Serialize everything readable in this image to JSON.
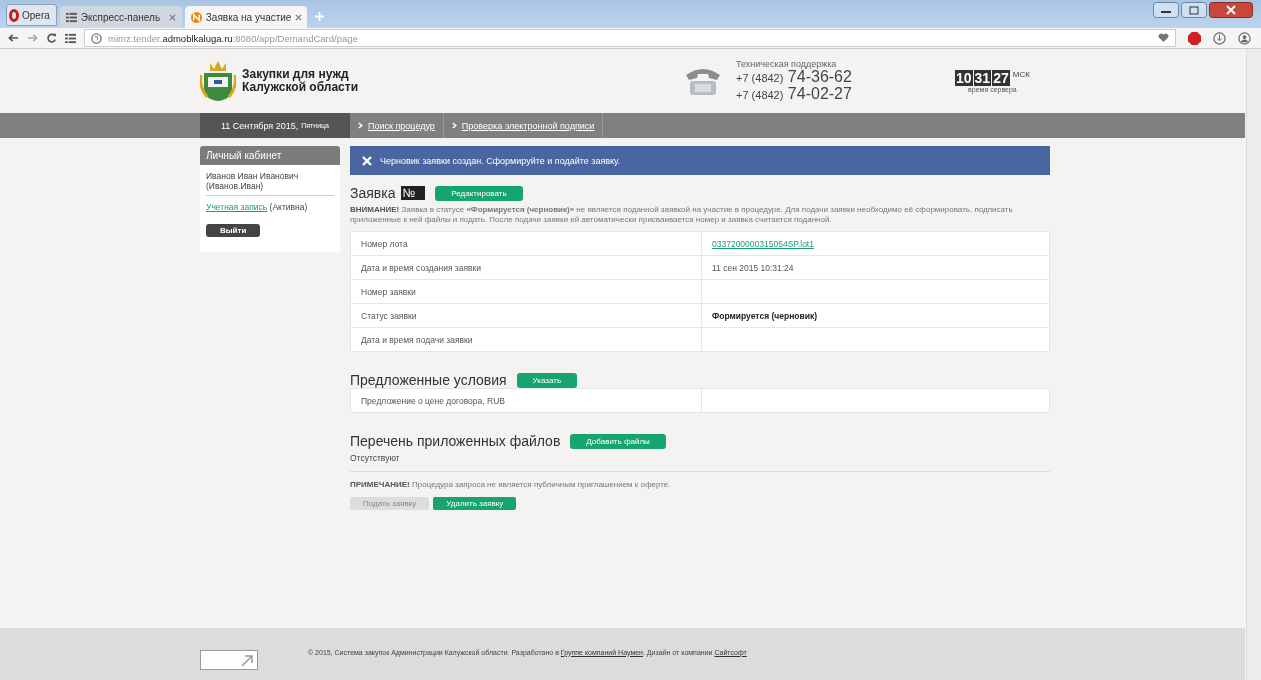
{
  "browser": {
    "menu_label": "Opera",
    "tabs": [
      {
        "label": "Экспресс-панель",
        "selected": false
      },
      {
        "label": "Заявка на участие",
        "selected": true
      }
    ],
    "url": {
      "prefix": "mimz.tender.",
      "host": "admoblkaluga.ru",
      "suffix": ":8080/app/DemandCard/page"
    }
  },
  "header": {
    "logo_text": [
      "Закупки для нужд",
      "Калужской области"
    ],
    "support_label": "Техническая поддержка",
    "phones": [
      {
        "code": "+7 (4842)",
        "number": "74-36-62"
      },
      {
        "code": "+7 (4842)",
        "number": "74-02-27"
      }
    ],
    "clock": {
      "digits": [
        "10",
        "31",
        "27"
      ],
      "zone": "МСК",
      "caption": "время сервера"
    }
  },
  "nav": {
    "date": "11 Сентября 2015,",
    "weekday": "Пятница",
    "links": [
      "Поиск процедур",
      "Проверка электронной подписи"
    ]
  },
  "sidebar": {
    "title": "Личный кабинет",
    "user": "Иванов Иван Иванович (Иванов.Иван)",
    "account_link": "Учетная запись",
    "account_status": "(Активна)",
    "logout": "Выйти"
  },
  "notice": "Черновик заявки создан. Сформируйте и подайте заявку.",
  "application": {
    "title": "Заявка",
    "number": "№",
    "number_highlighted": true,
    "edit_button": "Редактировать",
    "warning_lead": "ВНИМАНИЕ!",
    "warning": "Заявка в статусе **«Формируется (черновик)»** не является поданной заявкой на участие в процедуре. Для подачи заявки необходимо её сформировать, подписать приложенные к ней файлы и подать. После подачи заявки ей автоматически присваивается номер и заявка считается поданной.",
    "rows": [
      {
        "label": "Номер лота",
        "value": "0337200000315054SP.lot1",
        "kind": "link"
      },
      {
        "label": "Дата и время создания заявки",
        "value": "11 сен 2015 10:31:24",
        "kind": "text"
      },
      {
        "label": "Номер заявки"
      },
      {
        "label": "Статус заявки",
        "value": "Формируется (черновик)",
        "kind": "bold"
      },
      {
        "label": "Дата и время подачи заявки"
      }
    ]
  },
  "conditions": {
    "title": "Предложенные условия",
    "button": "Указать",
    "rows": [
      {
        "label": "Предложение о цене договора, RUB"
      }
    ]
  },
  "files": {
    "title": "Перечень приложенных файлов",
    "button": "Добавить файлы",
    "empty": "Отсутствуют"
  },
  "note_lead": "ПРИМЕЧАНИЕ!",
  "note": "Процедура запроса не является публичным приглашением к оферте.",
  "actions": [
    {
      "label": "Подать заявку",
      "disabled": true
    },
    {
      "label": "Удалить заявку",
      "disabled": false
    }
  ],
  "footer": {
    "text": "© 2015, Система закупок Администрации Калужской области. Разработано в",
    "link1": "Группе компаний Наумен",
    "middle": ". Дизайн от компании",
    "link2": "Сайтсофт"
  }
}
